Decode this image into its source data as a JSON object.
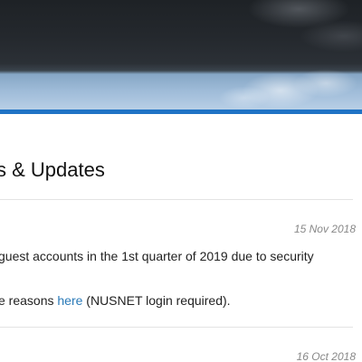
{
  "section": {
    "title": "s & Updates"
  },
  "news": [
    {
      "date": "15 Nov 2018",
      "line1": "guest accounts in the 1st quarter of 2019 due to security",
      "line2_before": "e reasons ",
      "line2_link": "here",
      "line2_after": " (NUSNET login required)."
    },
    {
      "date": "16 Oct 2018"
    }
  ],
  "colors": {
    "accent_bar": "#1f73c5",
    "link": "#2a7ab8",
    "date_text": "#888888",
    "divider": "#e3e3e3"
  }
}
